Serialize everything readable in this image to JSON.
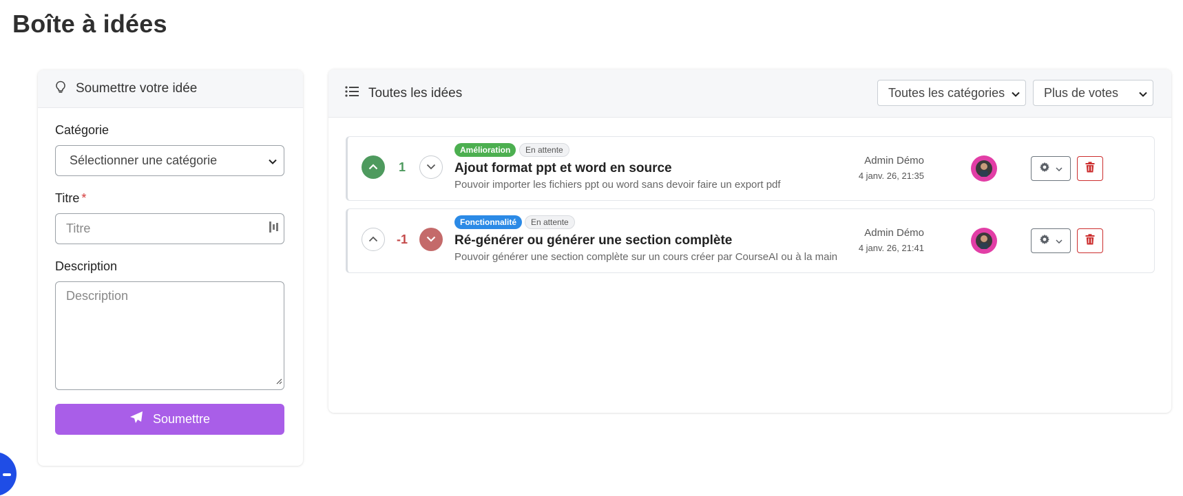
{
  "page": {
    "title": "Boîte à idées"
  },
  "submit_form": {
    "header": "Soumettre votre idée",
    "category_label": "Catégorie",
    "category_selected": "Sélectionner une catégorie",
    "title_label": "Titre",
    "title_required_mark": "*",
    "title_placeholder": "Titre",
    "description_label": "Description",
    "description_placeholder": "Description",
    "submit_label": "Soumettre",
    "submit_color": "#a95ee8"
  },
  "ideas_panel": {
    "header": "Toutes les idées",
    "category_filter": "Toutes les catégories",
    "sort_filter": "Plus de votes",
    "ideas": [
      {
        "category": "Amélioration",
        "category_color": "#4caf50",
        "status": "En attente",
        "votes": "1",
        "vote_state": "up",
        "title": "Ajout format ppt et word en source",
        "description": "Pouvoir importer les fichiers ppt ou word sans devoir faire un export pdf",
        "author": "Admin Démo",
        "date": "4 janv. 26, 21:35"
      },
      {
        "category": "Fonctionnalité",
        "category_color": "#2b8ae6",
        "status": "En attente",
        "votes": "-1",
        "vote_state": "down",
        "title": "Ré-générer ou générer une section complète",
        "description": "Pouvoir générer une section complète sur un cours créer par CourseAI ou à la main",
        "author": "Admin Démo",
        "date": "4 janv. 26, 21:41"
      }
    ]
  },
  "colors": {
    "vote_up": "#4e9a5e",
    "vote_down": "#c46a6a",
    "delete": "#cc2d2d",
    "avatar_bg": "#e23ea6"
  },
  "icons": [
    "lightbulb-icon",
    "list-icon",
    "chevron-up-icon",
    "chevron-down-icon",
    "gear-icon",
    "trash-icon",
    "paper-plane-icon",
    "avatar"
  ]
}
